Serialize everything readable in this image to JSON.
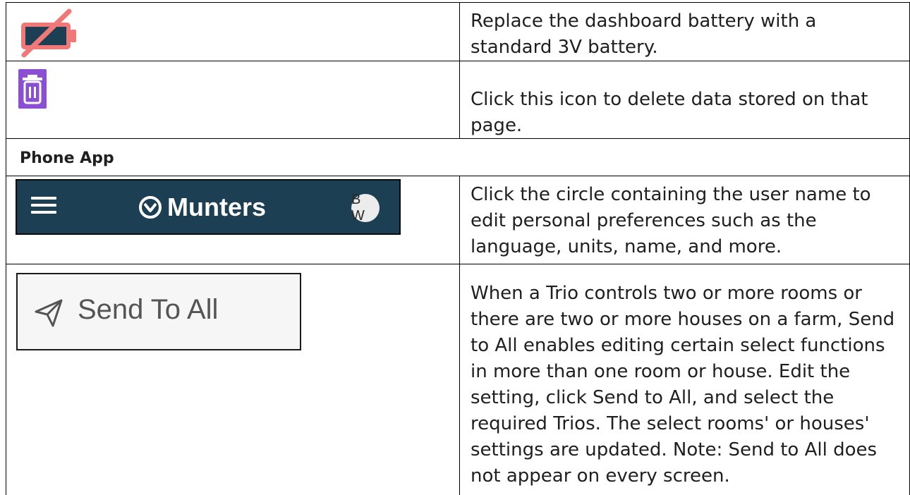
{
  "rows": [
    {
      "icon": "battery-crossed-icon",
      "description": "Replace the dashboard battery with a standard 3V battery."
    },
    {
      "icon": "trash-icon",
      "description": "Click this icon to delete data stored on that page."
    }
  ],
  "section": {
    "title": "Phone App"
  },
  "phone_rows": [
    {
      "header": {
        "menu_icon": "hamburger-icon",
        "logo_icon": "munters-logo-icon",
        "brand": "Munters",
        "avatar_initials": "B W"
      },
      "description": "Click the circle containing the user name to edit personal preferences such as the language, units, name, and more."
    },
    {
      "button": {
        "icon": "paper-plane-icon",
        "label": "Send To All"
      },
      "description": "When a Trio controls two or more rooms or there are two or more houses on a farm, Send to All enables editing certain select functions in more than one room or house. Edit the setting, click Send to All, and select the required Trios. The select rooms' or houses' settings are updated. Note: Send to All does not appear on every screen."
    }
  ],
  "colors": {
    "battery": "#f07878",
    "battery_body": "#1d3f53",
    "trash": "#8b4fd3",
    "header_bg": "#1d3f53",
    "button_bg": "#f6f6f6"
  }
}
